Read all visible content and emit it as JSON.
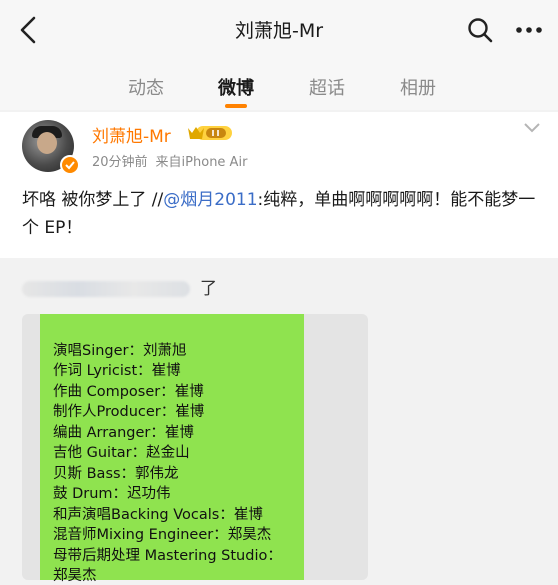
{
  "header": {
    "title": "刘萧旭-Mr"
  },
  "tabs": [
    {
      "label": "动态"
    },
    {
      "label": "微博"
    },
    {
      "label": "超话"
    },
    {
      "label": "相册"
    }
  ],
  "post": {
    "username": "刘萧旭-Mr",
    "time": "20分钟前",
    "source": "来自iPhone Air",
    "text_before": "坏咯 被你梦上了 //",
    "mention": "@烟月2011",
    "text_after": ":纯粹，单曲啊啊啊啊啊！能不能梦一个 EP！",
    "repost_tail": "了"
  },
  "credits": [
    "演唱Singer：刘萧旭",
    "作词 Lyricist：崔博",
    "作曲 Composer：崔博",
    "制作人Producer：崔博",
    "编曲 Arranger：崔博",
    "吉他 Guitar：赵金山",
    "贝斯 Bass：郭伟龙",
    "鼓 Drum：迟功伟",
    "和声演唱Backing Vocals：崔博",
    "混音师Mixing Engineer：郑昊杰",
    "母带后期处理 Mastering Studio：",
    "郑昊杰"
  ],
  "colors": {
    "accent": "#ff8200",
    "username": "#ff7800",
    "mention": "#3b6dc7",
    "credits_bg": "#8fe34f"
  }
}
